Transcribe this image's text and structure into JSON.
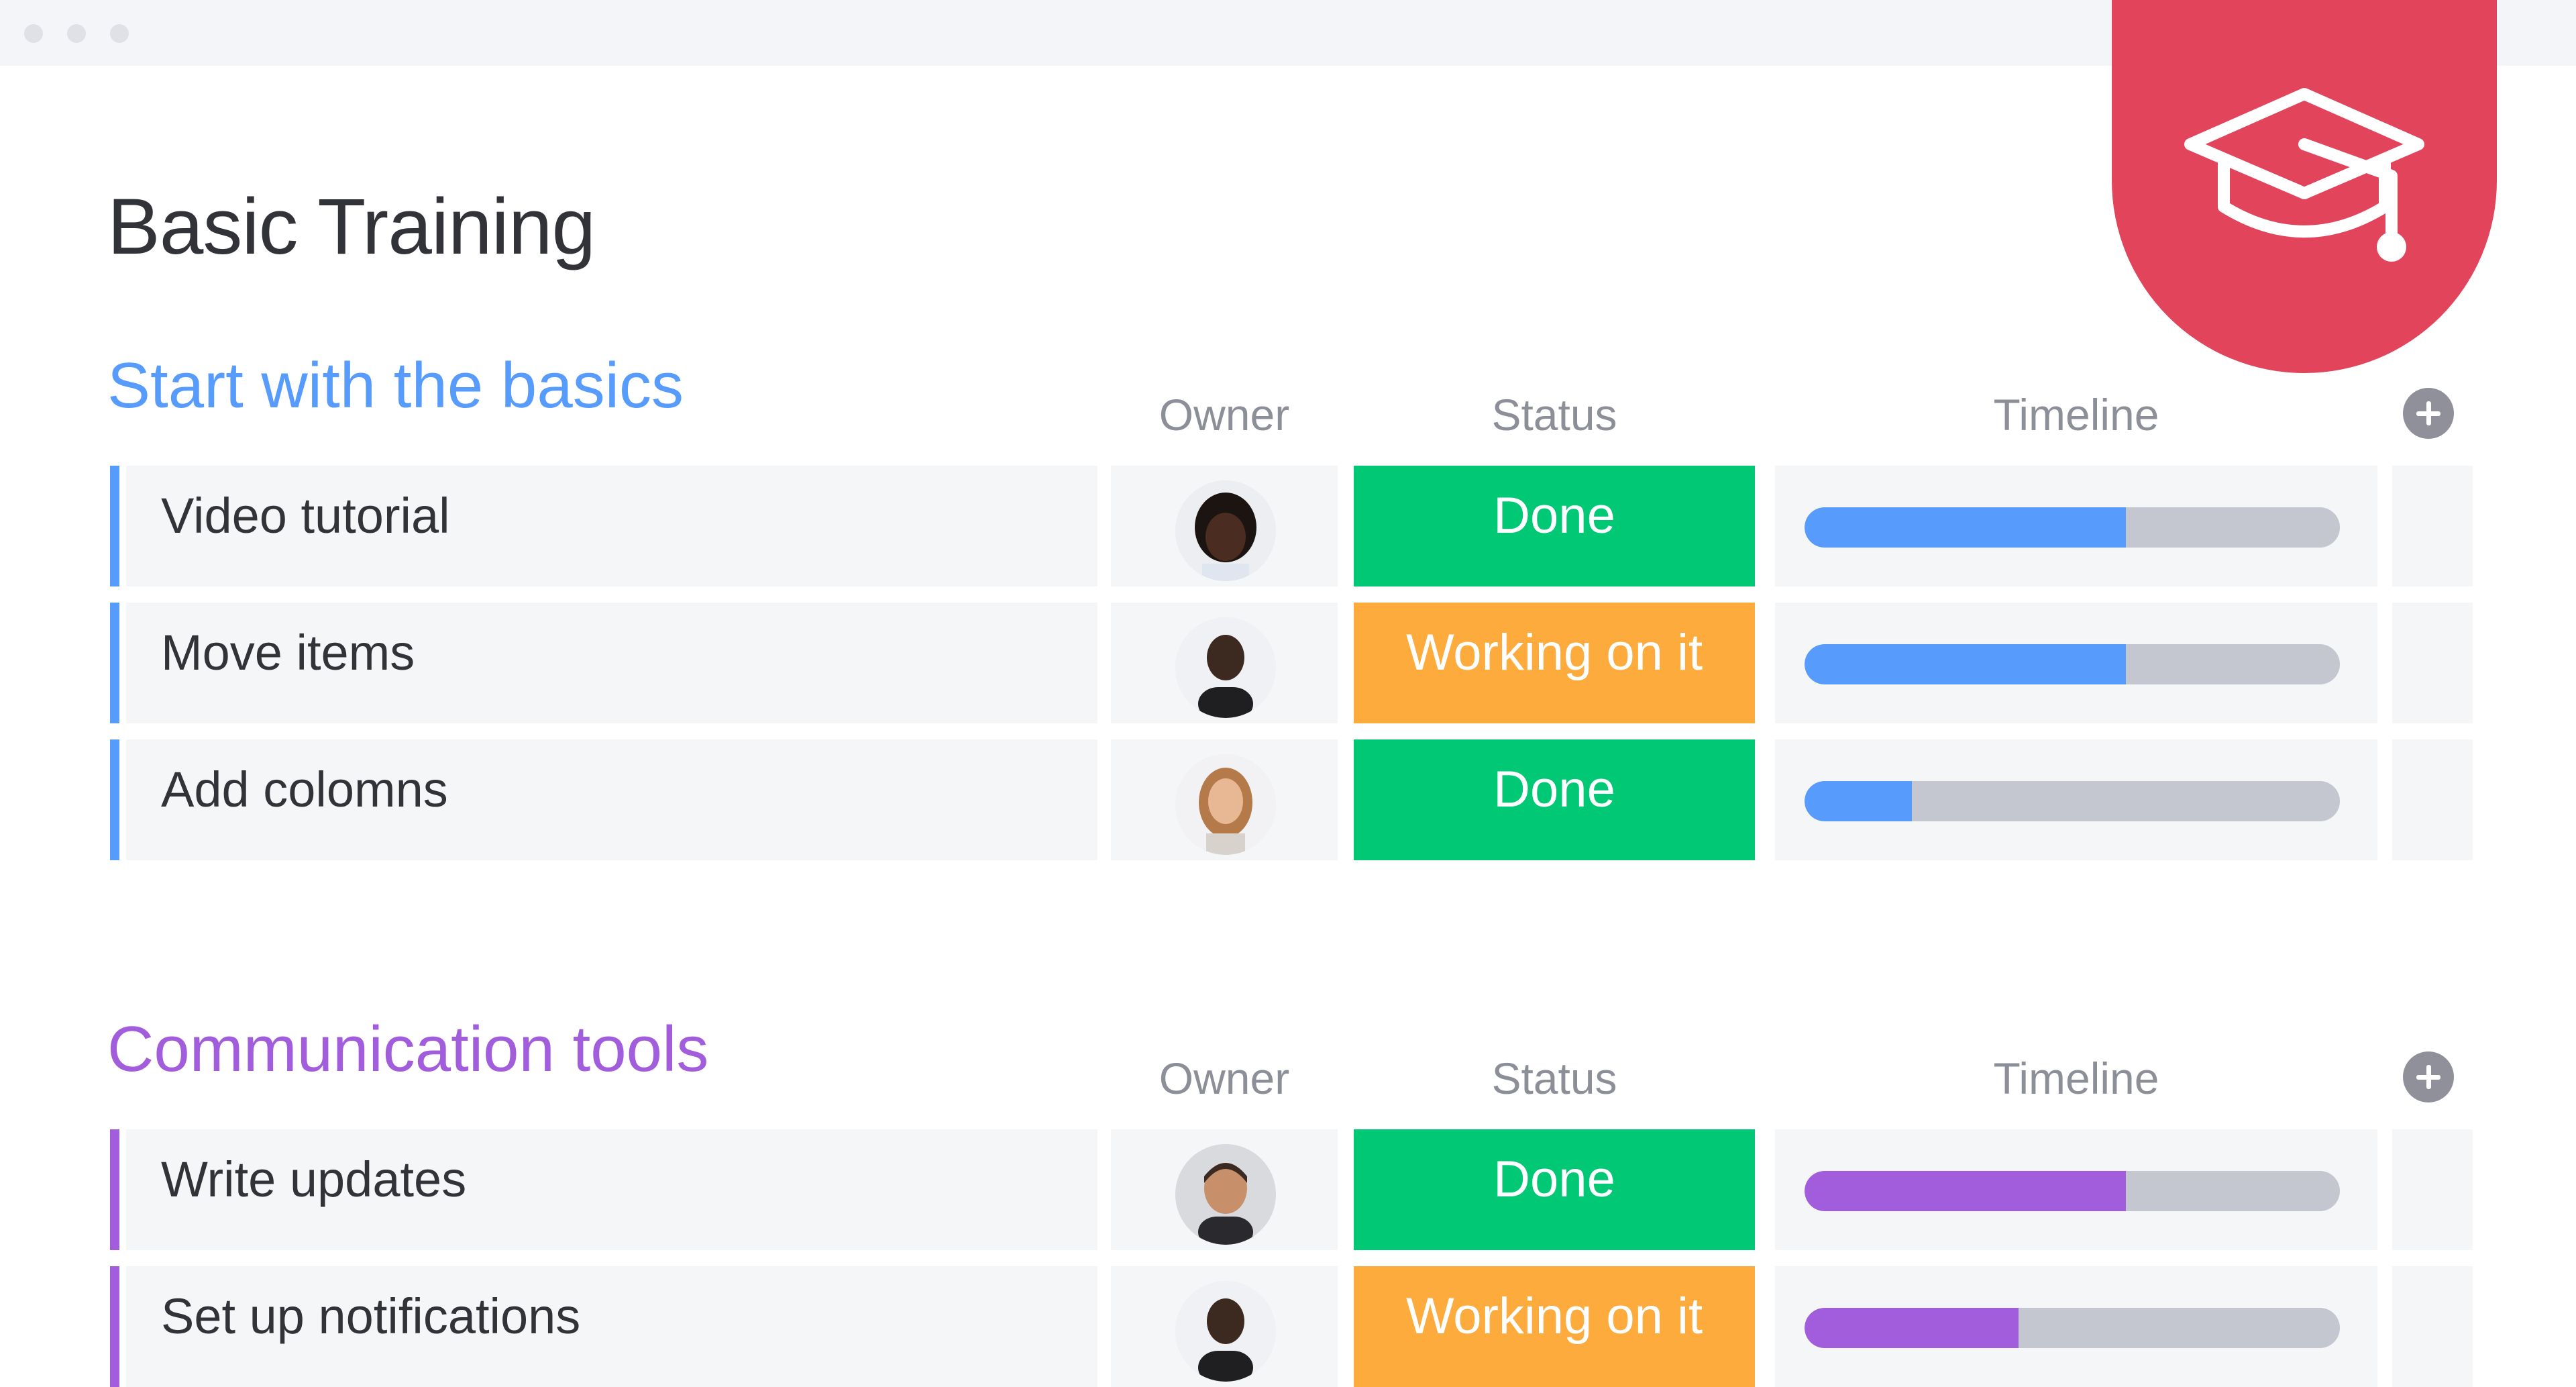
{
  "board": {
    "title": "Basic Training"
  },
  "badge": {
    "icon": "graduation-cap-icon",
    "color": "#e2445c"
  },
  "columns": {
    "owner": "Owner",
    "status": "Status",
    "timeline": "Timeline"
  },
  "groups": [
    {
      "title": "Start with the basics",
      "color": "#579bfc",
      "items": [
        {
          "name": "Video tutorial",
          "owner": "avatar-1",
          "status": "Done",
          "status_color": "#00c875",
          "timeline_progress": 0.6
        },
        {
          "name": "Move items",
          "owner": "avatar-2",
          "status": "Working on it",
          "status_color": "#fdab3d",
          "timeline_progress": 0.6
        },
        {
          "name": "Add colomns",
          "owner": "avatar-3",
          "status": "Done",
          "status_color": "#00c875",
          "timeline_progress": 0.2
        }
      ]
    },
    {
      "title": "Communication tools",
      "color": "#a25ddc",
      "items": [
        {
          "name": "Write updates",
          "owner": "avatar-4",
          "status": "Done",
          "status_color": "#00c875",
          "timeline_progress": 0.6
        },
        {
          "name": "Set up notifications",
          "owner": "avatar-2",
          "status": "Working on it",
          "status_color": "#fdab3d",
          "timeline_progress": 0.4
        }
      ]
    }
  ]
}
